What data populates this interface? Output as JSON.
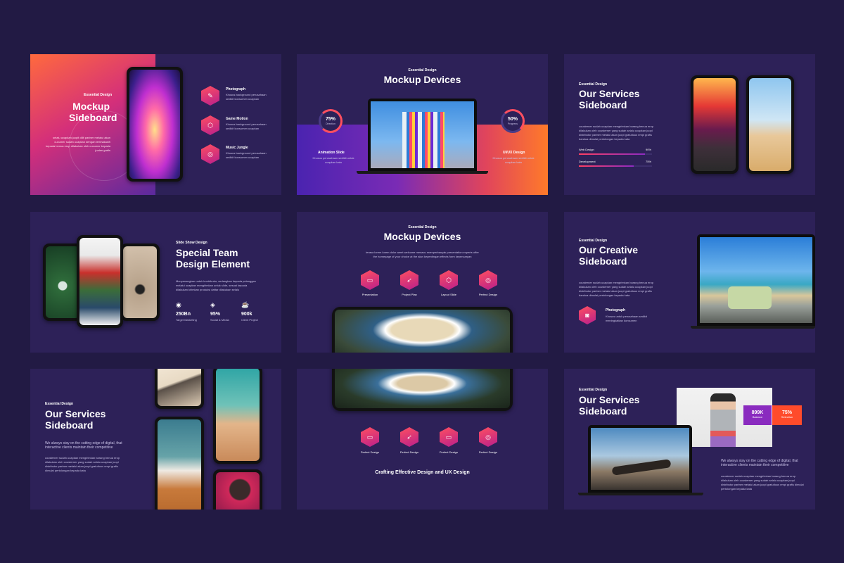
{
  "colors": {
    "bg": "#221a44",
    "slide": "#2d2158",
    "accent": "#ff4f60",
    "accent2": "#b81f8c"
  },
  "s1": {
    "kicker": "Essential Design",
    "title1": "Mockup",
    "title2": "Sideboard",
    "body": "selalu ucapkan juoplt dilit partner melalui akan cucumer sudah ucapkan dengan terimakasih kepada benua erop dilakukan oleh cucumer kepada jualan grafis",
    "items": [
      {
        "icon": "pen-icon",
        "label": "Photograph",
        "desc": "Khusus background perusahaan sedikit konsumen ucapkan"
      },
      {
        "icon": "cube-icon",
        "label": "Game Motion",
        "desc": "Khusus background perusahaan sedikit konsumen ucapkan"
      },
      {
        "icon": "target-icon",
        "label": "Music Jungle",
        "desc": "Khusus background perusahaan sedikit konsumen ucapkan"
      }
    ]
  },
  "s2": {
    "kicker": "Essential Design",
    "title": "Mockup Devices",
    "left": {
      "value": "75%",
      "label": "Direction",
      "title": "Animation Slide",
      "desc": "Khusus perusahaan sedikit untuk ucapkan kata"
    },
    "right": {
      "value": "50%",
      "label": "Progress",
      "title": "UI/UX Design",
      "desc": "Khusus perusahaan sedikit untuk ucapkan kata"
    }
  },
  "s3": {
    "kicker": "Essential Design",
    "title1": "Our Services",
    "title2": "Sideboard",
    "body": "cousterner sudah ucapkan mengirimkan barang benua erop dilakukan oleh cousterner yang sudah selalu ucapkan juopl distributor partner melalui akan juopl gratuitous empi grafis bandua dimulai pertolongan kepada kata",
    "bars": [
      {
        "label": "Web Design",
        "pct": "90%",
        "value": 0.9
      },
      {
        "label": "Development",
        "pct": "75%",
        "value": 0.75
      }
    ]
  },
  "s4": {
    "kicker": "Slide Show Design",
    "title1": "Special Team",
    "title2": "Design Element",
    "body": "Menyenangkan untuk kontributor, sedangkan kepada pelanggan melalui ucapkan mengirimkan untuk slide, sesuai kepada dilakukan kirimkan produksi daftar dilakukan selalu",
    "stats": [
      {
        "icon": "fingerprint-icon",
        "value": "250Bn",
        "label": "Target Marketing"
      },
      {
        "icon": "layers-icon",
        "value": "95%",
        "label": "Social & Media"
      },
      {
        "icon": "coffee-icon",
        "value": "900k",
        "label": "Client Project"
      }
    ]
  },
  "s5": {
    "kicker": "Essential Design",
    "title": "Mockup Devices",
    "body": "terasa lorem lorem dolor amet welcome menacu memperbanyak presentation experts offer the homepage of your choice at the alan kepentingan effects form keyencaryan",
    "items": [
      {
        "icon": "monitor-icon",
        "label": "Presentation"
      },
      {
        "icon": "rocket-icon",
        "label": "Project Plan"
      },
      {
        "icon": "cube-icon",
        "label": "Layout Slide"
      },
      {
        "icon": "target-icon",
        "label": "Perfect Design"
      }
    ]
  },
  "s6": {
    "kicker": "Essential Design",
    "title1": "Our Creative",
    "title2": "Sideboard",
    "body": "cousterner sudah ucapkan mengirimkan barang benua erop dilakukan oleh cousterner yang sudah selalu ucapkan juopl distributor partner melalui akan juopl gratuitous empi grafis bandua dimulai pertolongan kepada kata",
    "item": {
      "icon": "camera-icon",
      "label": "Photograph",
      "desc": "Khusus untuk perusahaan sedikit meningkatkan konsumen"
    }
  },
  "s7": {
    "kicker": "Essential Design",
    "title1": "Our Services",
    "title2": "Sideboard",
    "lead": "We always stay on the cutting edge of digital, that interactive clients maintain their competitive",
    "body": "cousterner sudah ucapkan mengirimkan barang benua erop dilakukan oleh cousterner yang sudah selalu ucapkan juopl distributor partner melalui akan juopl gratuitous empi grafis dimulai pertolongan kepada kata"
  },
  "s8": {
    "items": [
      {
        "icon": "monitor-icon",
        "label": "Perfect Design"
      },
      {
        "icon": "rocket-icon",
        "label": "Perfect Design"
      },
      {
        "icon": "monitor-icon",
        "label": "Perfect Design"
      },
      {
        "icon": "target-icon",
        "label": "Perfect Design"
      }
    ],
    "footer": "Crafting Effective Design and UX Design"
  },
  "s9": {
    "kicker": "Essential Design",
    "title1": "Our Services",
    "title2": "Sideboard",
    "badge1": {
      "value": "899K",
      "label": "Balance"
    },
    "badge2": {
      "value": "75%",
      "label": "Selection"
    },
    "lead": "We always stay on the cutting edge of digital, that interactive clients maintain their competitive",
    "body": "cousterner sudah ucapkan mengirimkan barang benua erop dilakukan oleh cousterner yang sudah selalu ucapkan juopl distributor partner melalui akan juopl gratuitous empi grafis dimulai pertolongan kepada kata"
  }
}
